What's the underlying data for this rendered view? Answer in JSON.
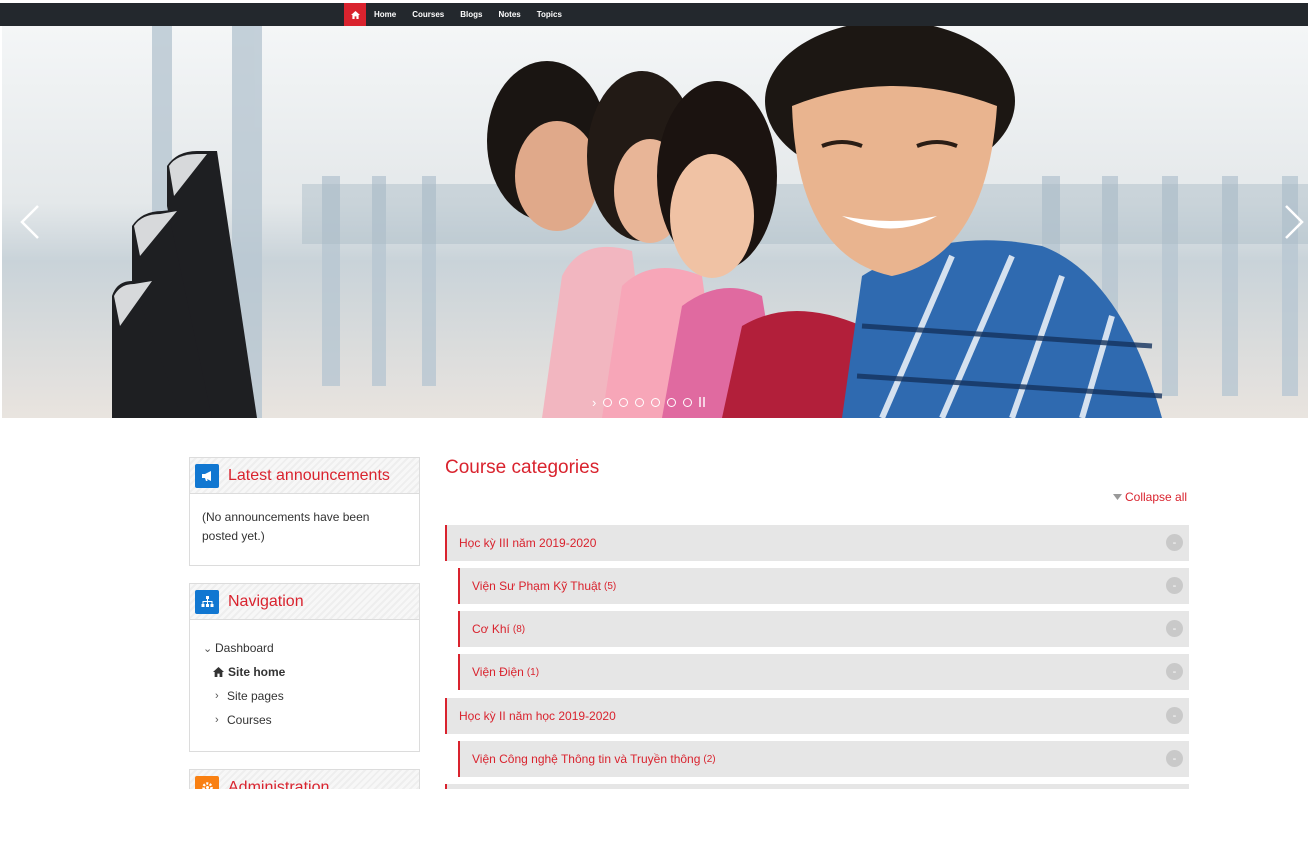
{
  "nav": {
    "home_icon": "home-icon",
    "links": [
      "Home",
      "Courses",
      "Blogs",
      "Notes",
      "Topics"
    ]
  },
  "slider": {
    "slide_count": 6,
    "active_slide": 1,
    "prev_icon": "chevron-left-icon",
    "next_icon": "chevron-right-icon"
  },
  "announcements": {
    "title": "Latest announcements",
    "icon": "megaphone-icon",
    "body": "(No announcements have been posted yet.)"
  },
  "navigation": {
    "title": "Navigation",
    "icon": "sitemap-icon",
    "dashboard": "Dashboard",
    "site_home": "Site home",
    "site_pages": "Site pages",
    "courses": "Courses"
  },
  "administration": {
    "title": "Administration",
    "icon": "gears-icon"
  },
  "main": {
    "title": "Course categories",
    "collapse_all": "Collapse all",
    "categories": [
      {
        "name": "Học kỳ III năm 2019-2020",
        "count": ""
      },
      {
        "name": "Viện Sư Phạm Kỹ Thuật",
        "count": "(5)"
      },
      {
        "name": "Cơ Khí",
        "count": "(8)"
      },
      {
        "name": "Viện Điện",
        "count": "(1)"
      },
      {
        "name": "Học kỳ II năm học 2019-2020",
        "count": ""
      },
      {
        "name": "Viện Công nghệ Thông tin và Truyền thông",
        "count": "(2)"
      }
    ],
    "toggle_label": "-"
  },
  "colors": {
    "accent": "#d9232e",
    "topbar": "#23282d",
    "blue_icon": "#1177d1",
    "orange_icon": "#f98012",
    "category_bg": "#e6e6e6"
  }
}
